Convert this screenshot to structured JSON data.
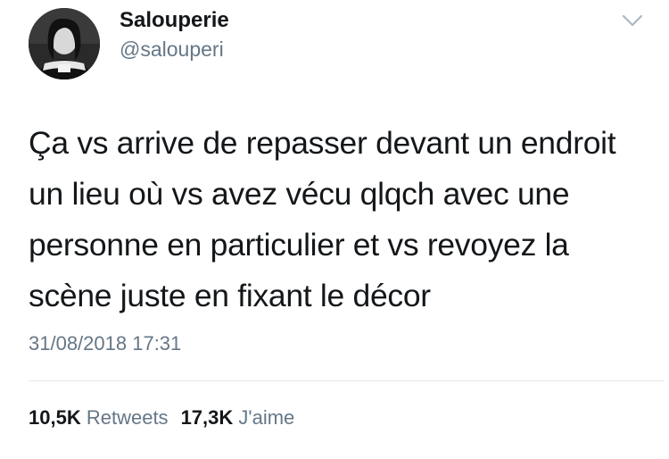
{
  "author": {
    "name": "Salouperie",
    "handle": "@salouperi"
  },
  "tweet": {
    "lines": [
      "Ça vs arrive de repasser devant un endroit",
      "un lieu où vs avez vécu qlqch avec une",
      "personne en particulier et vs revoyez la",
      "scène juste en fixant le décor"
    ],
    "timestamp": "31/08/2018 17:31"
  },
  "stats": {
    "retweets_count": "10,5K",
    "retweets_label": "Retweets",
    "likes_count": "17,3K",
    "likes_label": "J'aime"
  },
  "icons": {
    "menu": "chevron-down-icon"
  },
  "colors": {
    "text": "#14171a",
    "secondary": "#657786",
    "divider": "#e1e8ed"
  }
}
